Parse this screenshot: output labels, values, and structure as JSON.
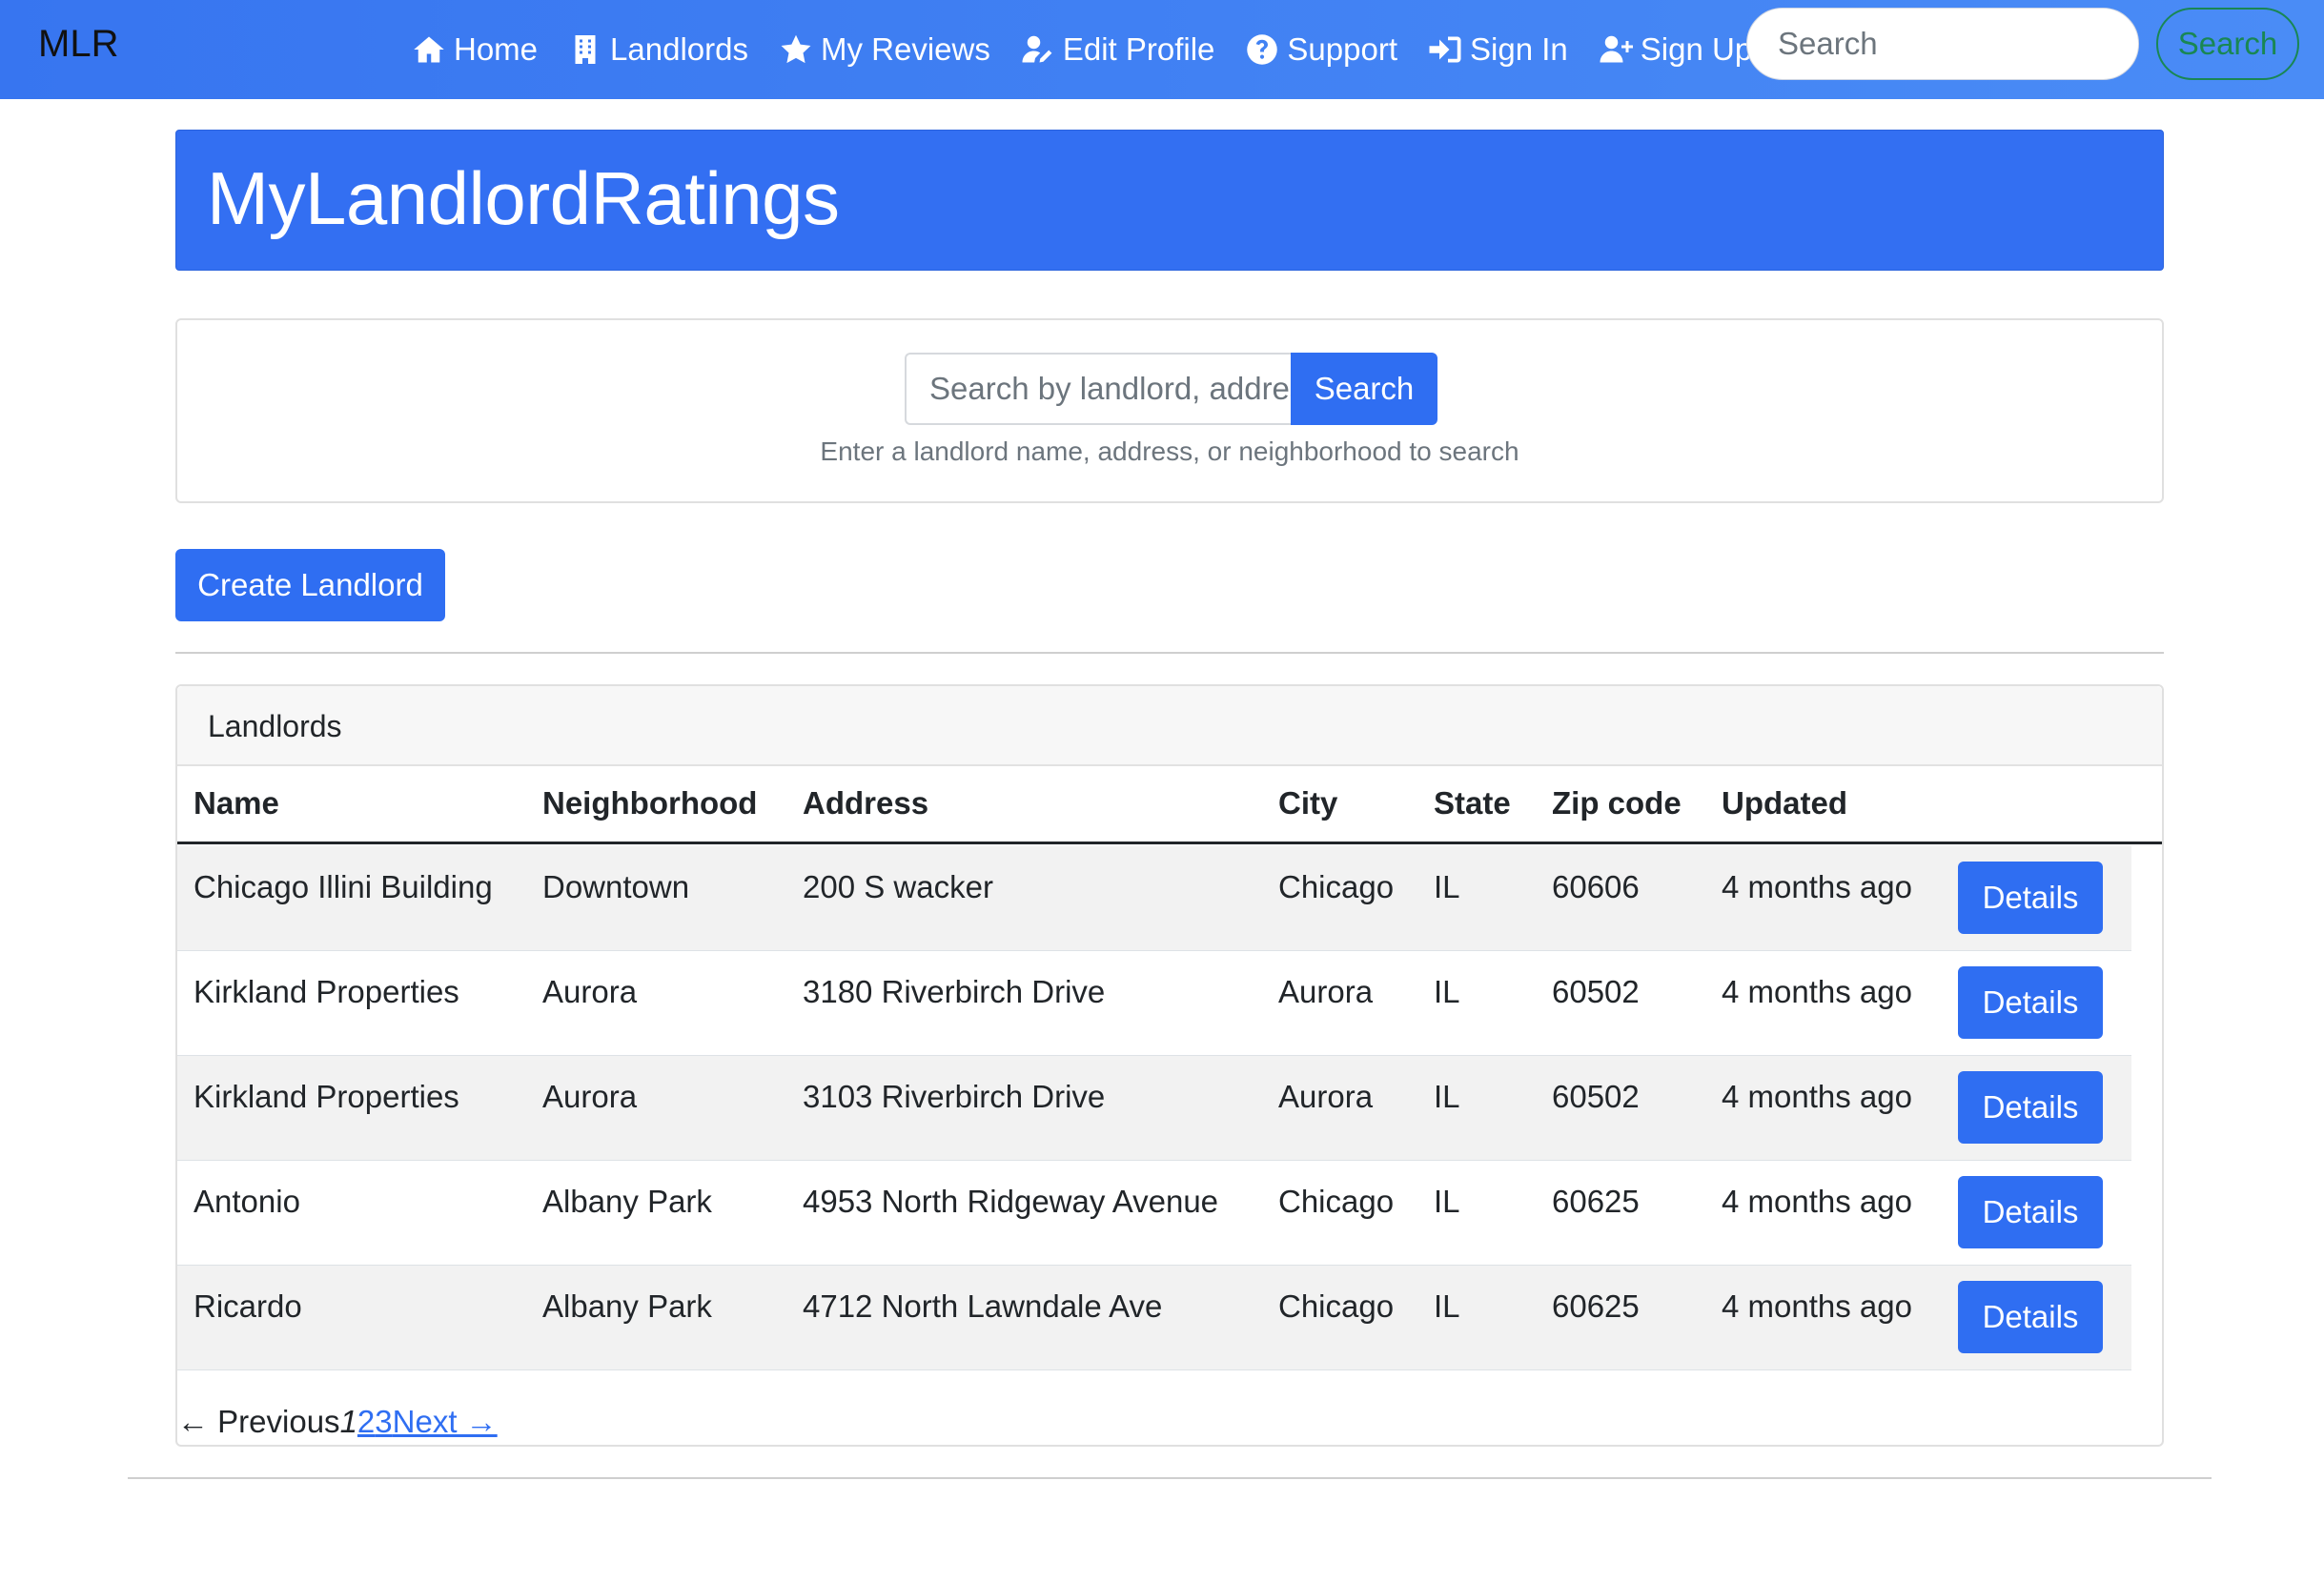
{
  "navbar": {
    "brand": "MLR",
    "links": [
      {
        "label": "Home",
        "icon": "home-icon"
      },
      {
        "label": "Landlords",
        "icon": "building-icon"
      },
      {
        "label": "My Reviews",
        "icon": "star-icon"
      },
      {
        "label": "Edit Profile",
        "icon": "user-edit-icon"
      },
      {
        "label": "Support",
        "icon": "question-circle-icon"
      },
      {
        "label": "Sign In",
        "icon": "sign-in-icon"
      },
      {
        "label": "Sign Up",
        "icon": "user-plus-icon"
      }
    ],
    "search_placeholder": "Search",
    "search_button": "Search"
  },
  "hero": {
    "title": "MyLandlordRatings"
  },
  "search": {
    "placeholder": "Search by landlord, address, or neighborhood",
    "button": "Search",
    "help": "Enter a landlord name, address, or neighborhood to search"
  },
  "actions": {
    "create": "Create Landlord"
  },
  "landlords": {
    "header": "Landlords",
    "columns": [
      "Name",
      "Neighborhood",
      "Address",
      "City",
      "State",
      "Zip code",
      "Updated"
    ],
    "details_label": "Details",
    "rows": [
      {
        "name": "Chicago Illini Building",
        "neighborhood": "Downtown",
        "address": "200 S wacker",
        "city": "Chicago",
        "state": "IL",
        "zip": "60606",
        "updated": "4 months ago"
      },
      {
        "name": "Kirkland Properties",
        "neighborhood": "Aurora",
        "address": "3180 Riverbirch Drive",
        "city": "Aurora",
        "state": "IL",
        "zip": "60502",
        "updated": "4 months ago"
      },
      {
        "name": "Kirkland Properties",
        "neighborhood": "Aurora",
        "address": "3103 Riverbirch Drive",
        "city": "Aurora",
        "state": "IL",
        "zip": "60502",
        "updated": "4 months ago"
      },
      {
        "name": "Antonio",
        "neighborhood": "Albany Park",
        "address": "4953 North Ridgeway Avenue",
        "city": "Chicago",
        "state": "IL",
        "zip": "60625",
        "updated": "4 months ago"
      },
      {
        "name": "Ricardo",
        "neighborhood": "Albany Park",
        "address": "4712 North Lawndale Ave",
        "city": "Chicago",
        "state": "IL",
        "zip": "60625",
        "updated": "4 months ago"
      }
    ]
  },
  "pagination": {
    "previous": "← Previous",
    "current": "1",
    "pages": [
      "2",
      "3"
    ],
    "next": "Next →"
  },
  "colors": {
    "navbar": "#4a8cf6",
    "primary": "#2f6ef2",
    "success": "#198754"
  }
}
